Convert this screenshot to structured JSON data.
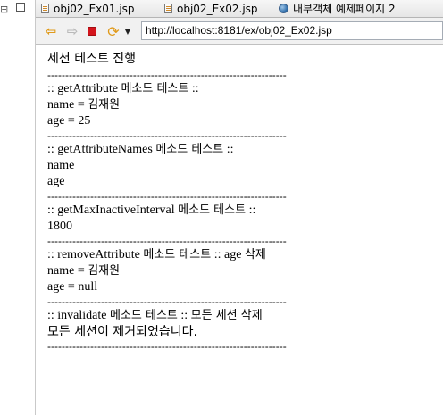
{
  "tabs": [
    {
      "label": "obj02_Ex01.jsp",
      "icon": "document-icon"
    },
    {
      "label": "obj02_Ex02.jsp",
      "icon": "document-icon"
    },
    {
      "label": "내부객체 예제페이지 2",
      "icon": "globe-icon"
    }
  ],
  "toolbar": {
    "url": "http://localhost:8181/ex/obj02_Ex02.jsp"
  },
  "page": {
    "title": "세션 테스트 진행",
    "separator": "-------------------------------------------------------------------",
    "sections": [
      {
        "heading_prefix": ":: getAttribute ",
        "heading_korean": "메소드 테스트",
        "heading_suffix": " ::",
        "lines": [
          {
            "latin": "name = ",
            "korean": "김재원"
          },
          {
            "latin": "age = 25",
            "korean": ""
          }
        ]
      },
      {
        "heading_prefix": ":: getAttributeNames ",
        "heading_korean": "메소드 테스트",
        "heading_suffix": " ::",
        "lines": [
          {
            "latin": "name",
            "korean": ""
          },
          {
            "latin": "age",
            "korean": ""
          }
        ]
      },
      {
        "heading_prefix": ":: getMaxInactiveInterval ",
        "heading_korean": "메소드 테스트",
        "heading_suffix": " ::",
        "lines": [
          {
            "latin": "1800",
            "korean": ""
          }
        ]
      },
      {
        "heading_prefix": ":: removeAttribute ",
        "heading_korean": "메소드 테스트",
        "heading_suffix": " :: age ",
        "heading_tail_korean": "삭제",
        "lines": [
          {
            "latin": "name = ",
            "korean": "김재원"
          },
          {
            "latin": "age = null",
            "korean": ""
          }
        ]
      },
      {
        "heading_prefix": ":: invalidate ",
        "heading_korean": "메소드 테스트",
        "heading_suffix": " :: ",
        "heading_tail_korean": "모든 세션 삭제",
        "final": "모든 세션이 제거되었습니다."
      }
    ]
  }
}
